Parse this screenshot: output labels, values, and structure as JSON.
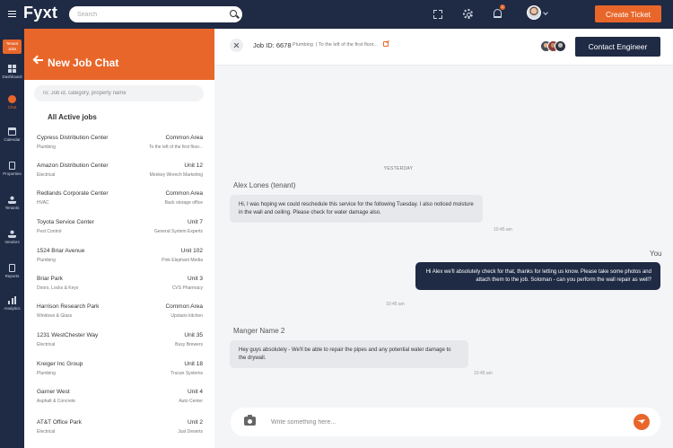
{
  "app": {
    "logo": "Fyxt"
  },
  "topbar": {
    "search_placeholder": "Search",
    "notification_count": "1",
    "create_ticket_label": "Create Ticket"
  },
  "nav": {
    "tenant_jobs": "Tenant Jobs",
    "items": [
      {
        "label": "Dashboard",
        "icon": "dashboard-grid-icon"
      },
      {
        "label": "Chat",
        "icon": "chat-icon"
      },
      {
        "label": "Calendar",
        "icon": "calendar-icon"
      },
      {
        "label": "Properties",
        "icon": "properties-icon"
      },
      {
        "label": "Tenants",
        "icon": "tenants-icon"
      },
      {
        "label": "Vendors",
        "icon": "vendors-icon"
      },
      {
        "label": "Reports",
        "icon": "reports-icon"
      },
      {
        "label": "Analytics",
        "icon": "analytics-icon"
      }
    ]
  },
  "jobpanel": {
    "title": "New Job Chat",
    "search_placeholder": "To: Job id, category, property name",
    "section_title": "All Active jobs",
    "jobs": [
      {
        "name": "Cypress Distribution Center",
        "category": "Plumbing",
        "unit": "Common Area",
        "location": "To the left of the first floor..."
      },
      {
        "name": "Amazon Distribution Center",
        "category": "Electrical",
        "unit": "Unit 12",
        "location": "Monkey Wrench Marketing"
      },
      {
        "name": "Redlands Corporate Center",
        "category": "HVAC",
        "unit": "Common Area",
        "location": "Back storage office"
      },
      {
        "name": "Toyota Service Center",
        "category": "Pest Control",
        "unit": "Unit 7",
        "location": "General System Experts"
      },
      {
        "name": "1524 Briar Avenue",
        "category": "Plumbing",
        "unit": "Unit 102",
        "location": "Pink Elephant Media"
      },
      {
        "name": "Briar Park",
        "category": "Doors, Locks & Keys",
        "unit": "Unit 3",
        "location": "CVS Pharmacy"
      },
      {
        "name": "Harrison Research Park",
        "category": "Windows & Glass",
        "unit": "Common Area",
        "location": "Upstairs kitchen"
      },
      {
        "name": "1231 WestChester Way",
        "category": "Electrical",
        "unit": "Unit 35",
        "location": "Busy Brewers"
      },
      {
        "name": "Kreiger Inc Group",
        "category": "Plumbing",
        "unit": "Unit 18",
        "location": "Trucan Systems"
      },
      {
        "name": "Garner West",
        "category": "Asphalt & Concrete",
        "unit": "Unit 4",
        "location": "Auto Center"
      },
      {
        "name": "AT&T Office Park",
        "category": "Electrical",
        "unit": "Unit 2",
        "location": "Just Deserts"
      }
    ]
  },
  "chat": {
    "job_id": "Job ID: 6678",
    "category": "Plumbing",
    "location": "|  To the left of the first floor...",
    "contact_label": "Contact Engineer",
    "date_separator": "YESTERDAY",
    "messages": [
      {
        "sender": "Alex Lones (tenant)",
        "text": "Hi, I was hoping we could reschedule this service for the following Tuesday. I also noticed moisture in the wall and ceiling. Please check for water damage also.",
        "time": "10:45 am"
      },
      {
        "sender": "You",
        "text": "Hi Alex we'll absolutely check for that, thanks for letting us know. Please take some photos and attach them to the job. Soloman - can you perform the wall repair as well?",
        "time": "10:45 am"
      },
      {
        "sender": "Manger Name 2",
        "text": "Hey guys absolutely - We'll be able to repair the pipes and any potential water damage to the drywall.",
        "time": "10:45 am"
      }
    ],
    "composer_placeholder": "Write something here..."
  }
}
